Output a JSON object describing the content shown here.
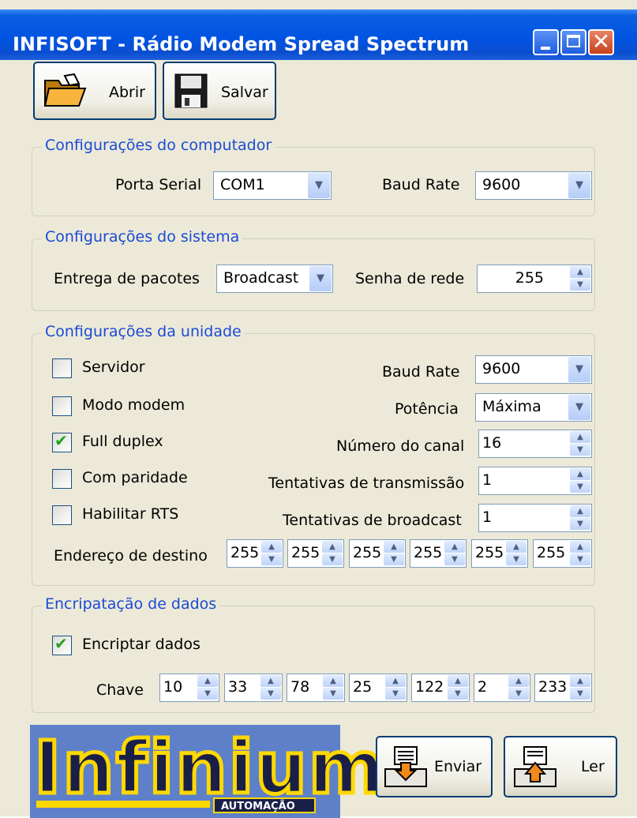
{
  "window": {
    "title": "INFISOFT - Rádio Modem Spread Spectrum",
    "controls": [
      "minimize-icon",
      "maximize-icon",
      "close-icon"
    ],
    "close_glyph": "✕"
  },
  "toolbar": {
    "open_label": "Abrir",
    "save_label": "Salvar"
  },
  "computer": {
    "group_title": "Configurações do computador",
    "serial_port_label": "Porta Serial",
    "serial_port_value": "COM1",
    "baud_rate_label": "Baud Rate",
    "baud_rate_value": "9600"
  },
  "system": {
    "group_title": "Configurações do sistema",
    "delivery_label": "Entrega de pacotes",
    "delivery_value": "Broadcast",
    "password_label": "Senha de rede",
    "password_value": "255"
  },
  "unit": {
    "group_title": "Configurações da unidade",
    "checkboxes": [
      {
        "label": "Servidor",
        "checked": false
      },
      {
        "label": "Modo modem",
        "checked": false
      },
      {
        "label": "Full duplex",
        "checked": true
      },
      {
        "label": "Com paridade",
        "checked": false
      },
      {
        "label": "Habilitar RTS",
        "checked": false
      }
    ],
    "baud_rate_label": "Baud Rate",
    "baud_rate_value": "9600",
    "power_label": "Potência",
    "power_value": "Máxima",
    "channel_label": "Número do canal",
    "channel_value": "16",
    "tx_retries_label": "Tentativas de transmissão",
    "tx_retries_value": "1",
    "bc_retries_label": "Tentativas de broadcast",
    "bc_retries_value": "1",
    "dest_label": "Endereço de destino",
    "dest_values": [
      "255",
      "255",
      "255",
      "255",
      "255",
      "255"
    ]
  },
  "encryption": {
    "group_title": "Encripatação de dados",
    "encrypt_label": "Encriptar dados",
    "encrypt_checked": true,
    "key_label": "Chave",
    "key_values": [
      "10",
      "33",
      "78",
      "25",
      "122",
      "2",
      "233"
    ]
  },
  "logo": {
    "word": "Infinium",
    "sub": "AUTOMAÇÃO"
  },
  "actions": {
    "send_label": "Enviar",
    "read_label": "Ler"
  },
  "colors": {
    "title_bar": "#0054e3",
    "group_title": "#1b4bd6",
    "check_mark": "#21a121",
    "logo_bg": "#5d80c9",
    "logo_yellow": "#ffd800"
  }
}
